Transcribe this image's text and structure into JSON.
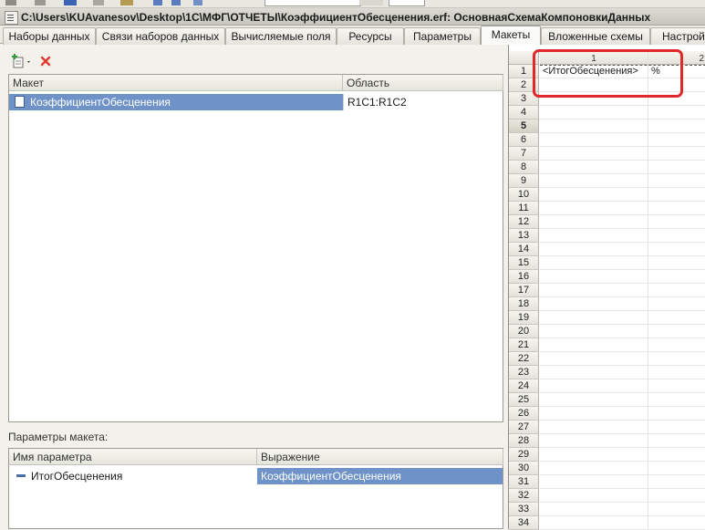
{
  "window": {
    "title": "C:\\Users\\KUAvanesov\\Desktop\\1С\\МФГ\\ОТЧЕТЫ\\КоэффициентОбесценения.erf: ОсновнаяСхемаКомпоновкиДанных"
  },
  "tabs": [
    {
      "label": "Наборы данных"
    },
    {
      "label": "Связи наборов данных"
    },
    {
      "label": "Вычисляемые поля"
    },
    {
      "label": "Ресурсы"
    },
    {
      "label": "Параметры"
    },
    {
      "label": "Макеты",
      "active": true
    },
    {
      "label": "Вложенные схемы"
    },
    {
      "label": "Настройк"
    }
  ],
  "toolbar": {
    "add_icon": "add-layout-icon",
    "delete_icon": "delete-icon",
    "delete_color": "#e03a2e"
  },
  "layouts_table": {
    "headers": [
      "Макет",
      "Область"
    ],
    "rows": [
      {
        "name": "КоэффициентОбесценения",
        "area": "R1C1:R1C2",
        "selected": true
      }
    ]
  },
  "params_section": {
    "label": "Параметры макета:",
    "headers": [
      "Имя параметра",
      "Выражение"
    ],
    "rows": [
      {
        "name": "ИтогОбесценения",
        "expression": "КоэффициентОбесценения"
      }
    ]
  },
  "sheet": {
    "columns": [
      "1",
      "2"
    ],
    "rows": [
      "1",
      "2",
      "3",
      "4",
      "5",
      "6",
      "7",
      "8",
      "9",
      "10",
      "11",
      "12",
      "13",
      "14",
      "15",
      "16",
      "17",
      "18",
      "19",
      "20",
      "21",
      "22",
      "23",
      "24",
      "25",
      "26",
      "27",
      "28",
      "29",
      "30",
      "31",
      "32",
      "33",
      "34"
    ],
    "cells": {
      "r1c1": "<ИтогОбесценения>",
      "r1c2": "%"
    },
    "highlight_color": "#e0282a",
    "selection_color": "#6f93c8"
  }
}
